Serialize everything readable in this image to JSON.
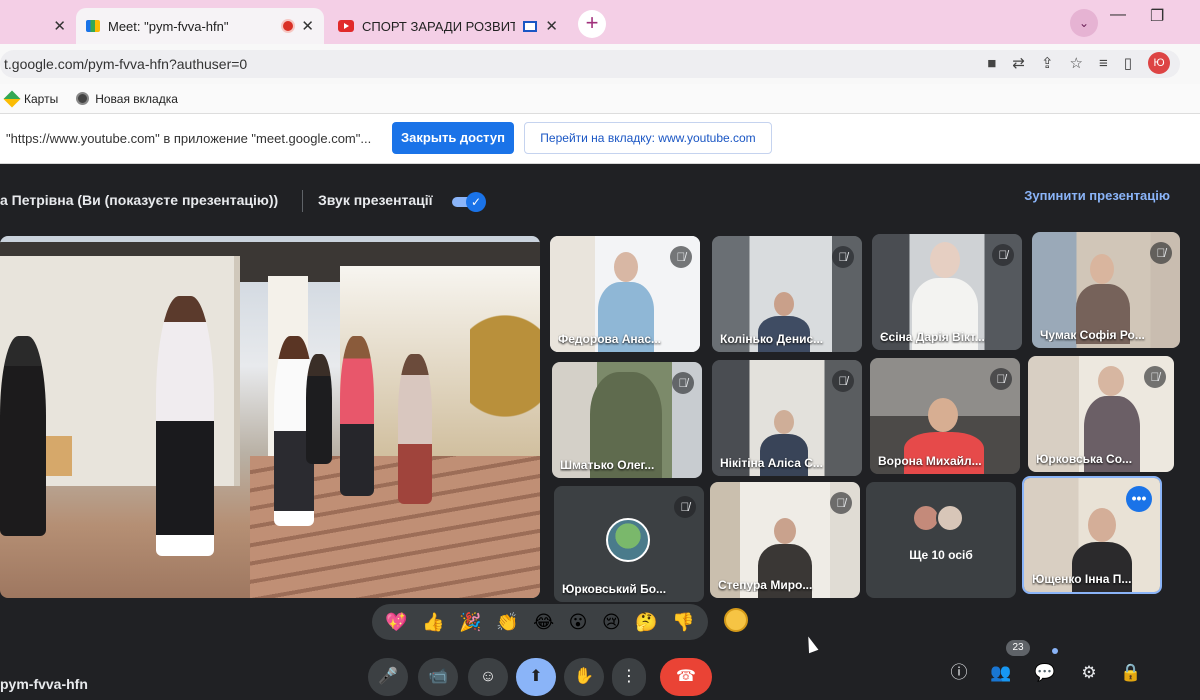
{
  "browser": {
    "tabs": [
      {
        "label": "",
        "active": false
      },
      {
        "label": "Meet: \"pym-fvva-hfn\"",
        "active": true
      },
      {
        "label": "СПОРТ ЗАРАДИ РОЗВИТКУ",
        "active": false
      }
    ],
    "tab_close": "✕",
    "new_tab": "+",
    "tab_search": "⌄",
    "window_controls": [
      "—",
      "❐"
    ],
    "url": "t.google.com/pym-fvva-hfn?authuser=0",
    "profile_initial": "Ю",
    "toolbar_icons": [
      "■",
      "⇄",
      "⇪",
      "☆",
      "≡",
      "▯"
    ],
    "bookmarks": [
      "Карты",
      "Новая вкладка"
    ]
  },
  "share_bar": {
    "text": "\"https://www.youtube.com\" в приложение \"meet.google.com\"...",
    "stop_button": "Закрыть доступ",
    "goto_button": "Перейти на вкладку: www.youtube.com"
  },
  "meet": {
    "presenter_label": "а Петрівна (Ви (показуєте презентацію))",
    "sound_label": "Звук презентації",
    "sound_on": true,
    "stop_presentation": "Зупинити презентацію",
    "mute_glyph": "🎙̸",
    "participants": [
      "Федорова Анас...",
      "Колінько Денис...",
      "Єсіна Дарія Вікт...",
      "Чумак Софія Ро...",
      "Шматько Олег...",
      "Нікітіна Аліса С...",
      "Ворона Михайл...",
      "Юрковська Со...",
      "Юрковський Бо...",
      "Степура Миро...",
      "Ще 10 осіб",
      "Ющенко Інна П..."
    ],
    "self_options": "•••",
    "reactions": [
      "💖",
      "👍",
      "🎉",
      "👏",
      "😂",
      "😮",
      "😢",
      "🤔",
      "👎"
    ],
    "meeting_code": "pym-fvva-hfn",
    "controls": {
      "mic": "🎤",
      "camera": "📹",
      "reactions": "☺",
      "present": "⬆",
      "hand": "✋",
      "more": "⋮",
      "leave": "☎"
    },
    "right_controls": [
      "ⓘ",
      "👥",
      "💬",
      "⚙",
      "🔒"
    ],
    "participant_count": "23"
  }
}
